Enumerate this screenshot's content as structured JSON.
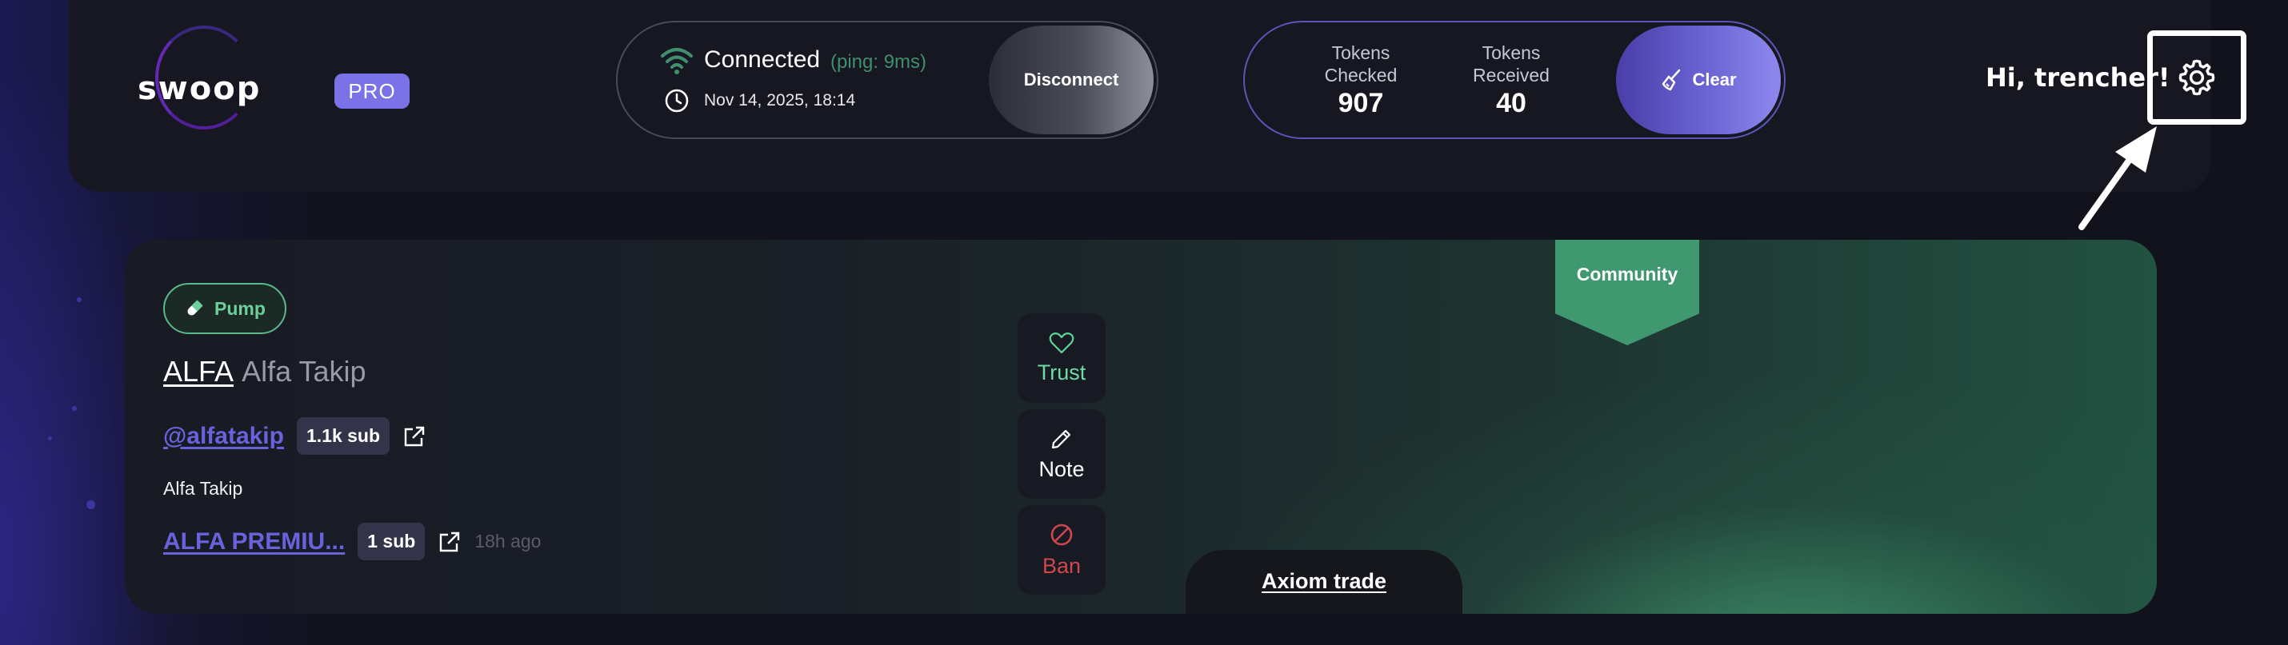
{
  "brand": {
    "logo_text": "swoop",
    "pro_badge": "PRO"
  },
  "connection": {
    "status": "Connected",
    "ping": "(ping: 9ms)",
    "datetime": "Nov 14, 2025, 18:14",
    "disconnect_label": "Disconnect",
    "status_color": "#3f8f6c"
  },
  "tokens": {
    "checked_label_1": "Tokens",
    "checked_label_2": "Checked",
    "checked_value": "907",
    "received_label_1": "Tokens",
    "received_label_2": "Received",
    "received_value": "40",
    "clear_label": "Clear"
  },
  "user": {
    "greeting": "Hi, trencher!"
  },
  "token_card": {
    "platform_badge": "Pump",
    "ticker": "ALFA",
    "name": "Alfa Takip",
    "social_handle": "@alfatakip",
    "social_subs": "1.1k sub",
    "description": "Alfa Takip",
    "channel_name": "ALFA PREMIU...",
    "channel_subs": "1 sub",
    "age": "18h ago",
    "community_tag": "Community",
    "axiom_link": "Axiom trade",
    "accent_color": "#3f9870"
  },
  "actions": {
    "trust": "Trust",
    "note": "Note",
    "ban": "Ban"
  },
  "icons": [
    "wifi-icon",
    "clock-icon",
    "broom-icon",
    "gear-icon",
    "arrow-annotation",
    "pill-icon",
    "external-link-icon",
    "heart-icon",
    "pencil-icon",
    "ban-icon"
  ]
}
